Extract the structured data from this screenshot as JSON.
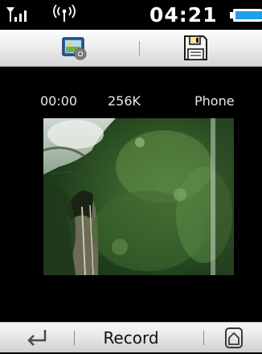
{
  "status_bar": {
    "time": "04:21",
    "signal_icon": "signal-bars-icon",
    "wireless_icon": "wireless-broadcast-icon",
    "battery_icon": "battery-icon"
  },
  "top_toolbar": {
    "settings_icon": "camera-settings-icon",
    "save_icon": "floppy-disk-icon"
  },
  "recording_info": {
    "duration": "00:00",
    "size": "256K",
    "storage": "Phone"
  },
  "bottom_toolbar": {
    "back_icon": "return-arrow-icon",
    "record_label": "Record",
    "home_icon": "home-icon"
  },
  "colors": {
    "background": "#000000",
    "toolbar": "#e6e6e6",
    "battery_accent": "#1ea0e8"
  }
}
